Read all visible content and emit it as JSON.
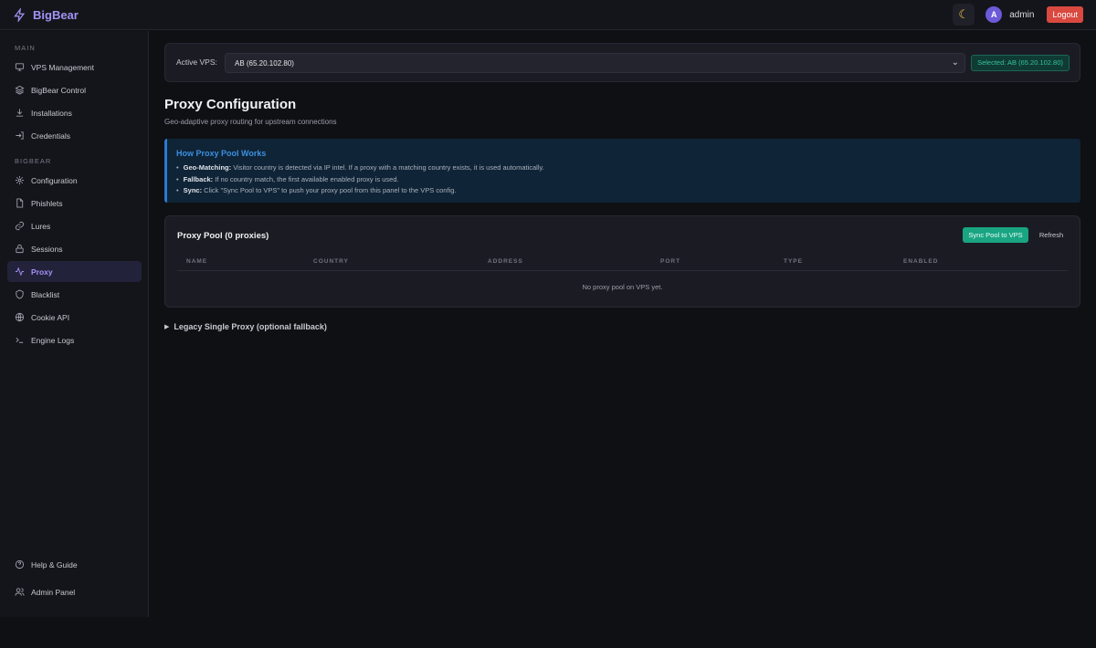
{
  "app": {
    "name": "BigBear"
  },
  "topbar": {
    "theme_icon": "moon-icon",
    "avatar_initial": "A",
    "username": "admin",
    "logout_label": "Logout"
  },
  "sidebar": {
    "section_main": "MAIN",
    "main_items": [
      {
        "label": "VPS Management",
        "icon": "monitor-icon"
      },
      {
        "label": "BigBear Control",
        "icon": "layers-icon"
      },
      {
        "label": "Installations",
        "icon": "download-icon"
      },
      {
        "label": "Credentials",
        "icon": "login-icon"
      }
    ],
    "section_bigbear": "BIGBEAR",
    "bigbear_items": [
      {
        "label": "Configuration",
        "icon": "gear-icon"
      },
      {
        "label": "Phishlets",
        "icon": "file-icon"
      },
      {
        "label": "Lures",
        "icon": "link-icon"
      },
      {
        "label": "Sessions",
        "icon": "lock-icon"
      },
      {
        "label": "Proxy",
        "icon": "activity-icon",
        "active": true
      },
      {
        "label": "Blacklist",
        "icon": "shield-icon"
      },
      {
        "label": "Cookie API",
        "icon": "globe-icon"
      },
      {
        "label": "Engine Logs",
        "icon": "terminal-icon"
      }
    ],
    "footer_items": [
      {
        "label": "Help & Guide",
        "icon": "help-icon"
      },
      {
        "label": "Admin Panel",
        "icon": "users-icon"
      }
    ]
  },
  "vps": {
    "label": "Active VPS:",
    "selected_value": "AB (65.20.102.80)",
    "badge": "Selected: AB (65.20.102.80)"
  },
  "page": {
    "title": "Proxy Configuration",
    "subtitle": "Geo-adaptive proxy routing for upstream connections"
  },
  "info": {
    "title": "How Proxy Pool Works",
    "items": [
      {
        "term": "Geo-Matching:",
        "text": " Visitor country is detected via IP intel. If a proxy with a matching country exists, it is used automatically."
      },
      {
        "term": "Fallback:",
        "text": " If no country match, the first available enabled proxy is used."
      },
      {
        "term": "Sync:",
        "text": " Click \"Sync Pool to VPS\" to push your proxy pool from this panel to the VPS config."
      }
    ]
  },
  "pool": {
    "title": "Proxy Pool (0 proxies)",
    "sync_label": "Sync Pool to VPS",
    "refresh_label": "Refresh",
    "columns": [
      "NAME",
      "COUNTRY",
      "ADDRESS",
      "PORT",
      "TYPE",
      "ENABLED"
    ],
    "empty_message": "No proxy pool on VPS yet."
  },
  "legacy": {
    "label": "Legacy Single Proxy (optional fallback)"
  },
  "colors": {
    "accent": "#a392f5",
    "success": "#1aa582",
    "danger": "#d9493f",
    "info": "#3d8fe0"
  }
}
